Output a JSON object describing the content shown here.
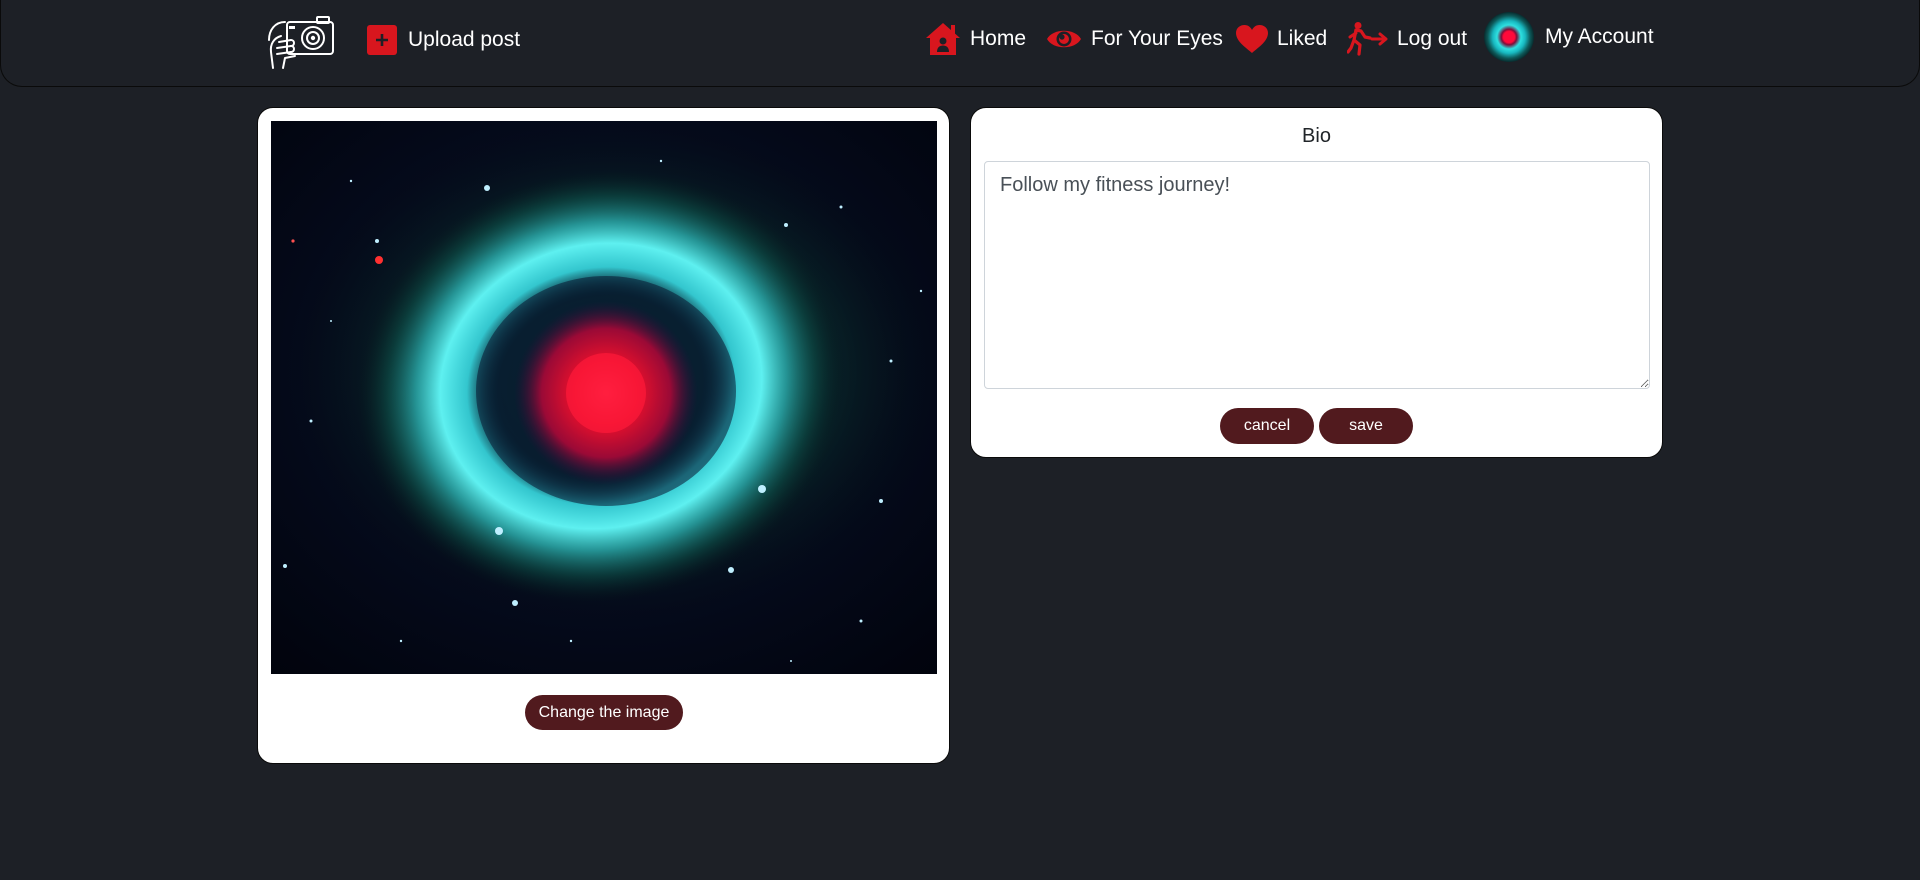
{
  "nav": {
    "logo_icon": "camera-in-hand-icon",
    "upload": {
      "label": "Upload post",
      "icon": "plus-square-icon"
    },
    "home": {
      "label": "Home",
      "icon": "house-icon"
    },
    "eyes": {
      "label": "For Your Eyes",
      "icon": "eye-icon"
    },
    "liked": {
      "label": "Liked",
      "icon": "heart-icon"
    },
    "logout": {
      "label": "Log out",
      "icon": "running-exit-icon"
    },
    "account": {
      "label": "My Account",
      "icon": "avatar-nebula"
    }
  },
  "profile_image": {
    "alt": "Helix nebula",
    "change_label": "Change the image"
  },
  "bio": {
    "label": "Bio",
    "value": "Follow my fitness journey!",
    "cancel_label": "cancel",
    "save_label": "save"
  },
  "colors": {
    "background": "#1d2026",
    "accent_red": "#d8161e",
    "button": "#511a1e",
    "card": "#ffffff"
  }
}
